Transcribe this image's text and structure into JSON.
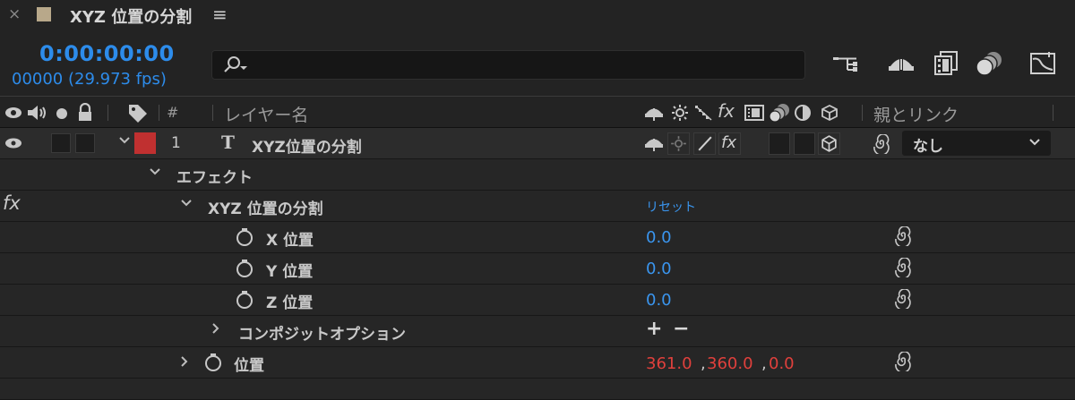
{
  "tab": {
    "close": "×",
    "title": "XYZ 位置の分割",
    "menu": "≡",
    "swatch_color": "#b8a88a"
  },
  "header": {
    "timecode": "0:00:00:00",
    "framecount": "00000 (29.973 fps)",
    "search_placeholder": "",
    "icons": [
      "composition-flowchart-icon",
      "draft-3d-icon",
      "frame-blending-icon",
      "motion-blur-icon",
      "graph-editor-icon"
    ]
  },
  "columns": {
    "number": "#",
    "layer_name": "レイヤー名",
    "parent_link": "親とリンク"
  },
  "layer": {
    "index": "1",
    "type_icon": "T",
    "name": "XYZ位置の分割",
    "label_color": "#c03030",
    "parent_value": "なし"
  },
  "tree": {
    "effects_label": "エフェクト",
    "effect_name": "XYZ 位置の分割",
    "reset_label": "リセット",
    "props": [
      {
        "label": "X 位置",
        "value": "0.0"
      },
      {
        "label": "Y 位置",
        "value": "0.0"
      },
      {
        "label": "Z 位置",
        "value": "0.0"
      }
    ],
    "composite_label": "コンポジットオプション",
    "composite_controls": "+ −",
    "position_label": "位置",
    "position_values": [
      "361.0",
      "360.0",
      "0.0"
    ],
    "fx_label": "fx"
  },
  "colors": {
    "value_blue": "#3a95ee",
    "value_red": "#e0403c",
    "timecode_blue": "#2d8ceb"
  }
}
